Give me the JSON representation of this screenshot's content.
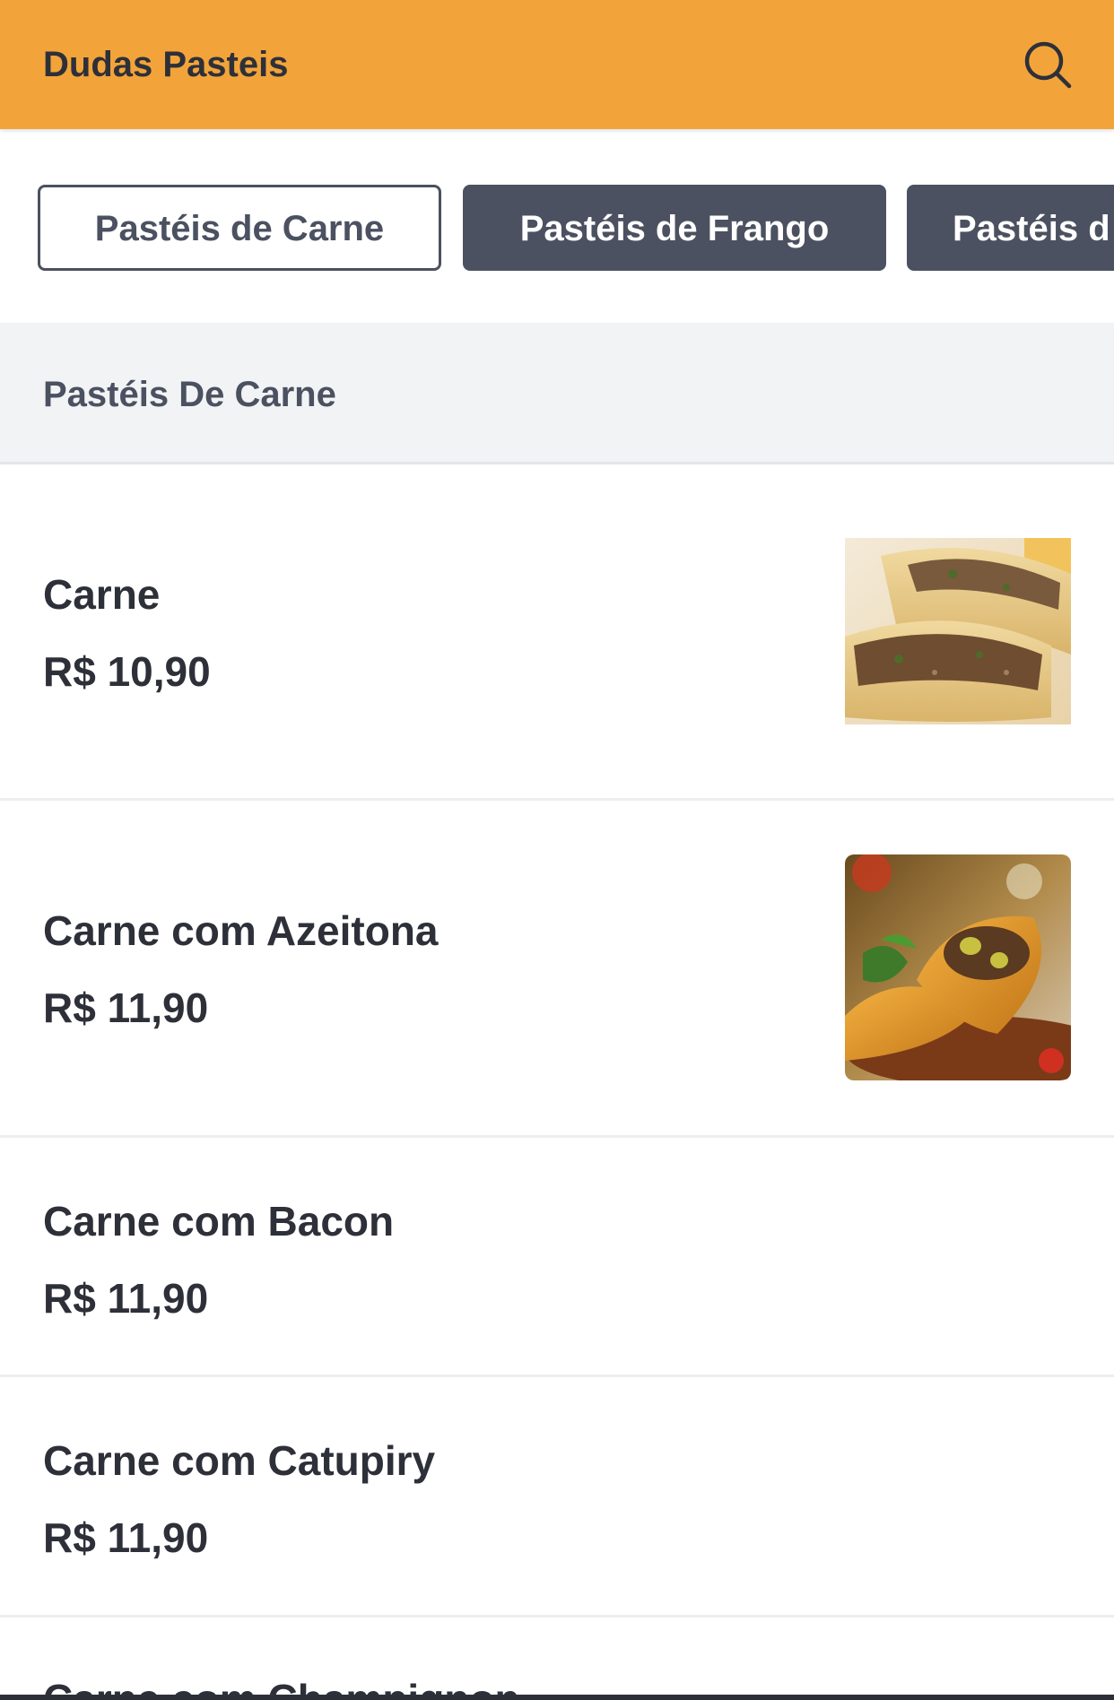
{
  "header": {
    "title": "Dudas Pasteis",
    "search_icon": "search-icon",
    "background_color": "#f2a43a"
  },
  "tabs": [
    {
      "label": "Pastéis de Carne",
      "active": true
    },
    {
      "label": "Pastéis de Frango",
      "active": false
    },
    {
      "label": "Pastéis d",
      "active": false
    }
  ],
  "section": {
    "title": "Pastéis De Carne"
  },
  "items": [
    {
      "name": "Carne",
      "price": "R$ 10,90",
      "image": "pastel-carne-photo"
    },
    {
      "name": "Carne com Azeitona",
      "price": "R$ 11,90",
      "image": "pastel-carne-azeitona-photo"
    },
    {
      "name": "Carne com Bacon",
      "price": "R$ 11,90"
    },
    {
      "name": "Carne com Catupiry",
      "price": "R$ 11,90"
    },
    {
      "name": "Carne com Champignon"
    }
  ],
  "colors": {
    "accent": "#f2a43a",
    "tab_dark": "#4b5160",
    "text": "#2e3039",
    "section_bg": "#f2f3f5"
  }
}
